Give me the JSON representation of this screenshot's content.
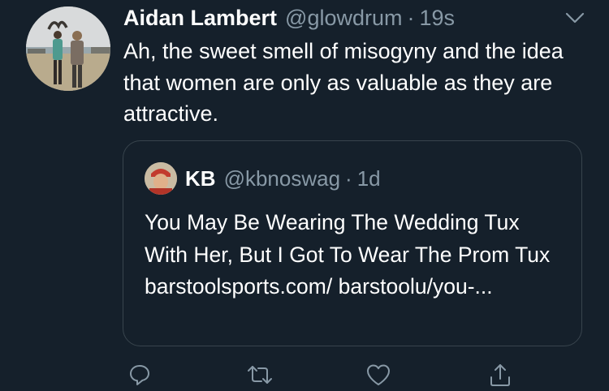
{
  "tweet": {
    "author_name": "Aidan Lambert",
    "author_handle": "@glowdrum",
    "separator": "·",
    "timestamp": "19s",
    "text": "Ah, the sweet smell of misogyny and the idea that women are only as valuable as they are attractive."
  },
  "quoted_tweet": {
    "author_name": "KB",
    "author_handle": "@kbnoswag",
    "separator": "·",
    "timestamp": "1d",
    "text": "You May Be Wearing The Wedding Tux With Her, But I Got To Wear The Prom Tux barstoolsports.com/ barstoolu/you-..."
  },
  "actions": [
    "reply-icon",
    "retweet-icon",
    "like-icon",
    "share-icon"
  ],
  "colors": {
    "background": "#15202b",
    "text": "#ffffff",
    "secondary_text": "#8899a6",
    "border": "#38444d"
  }
}
